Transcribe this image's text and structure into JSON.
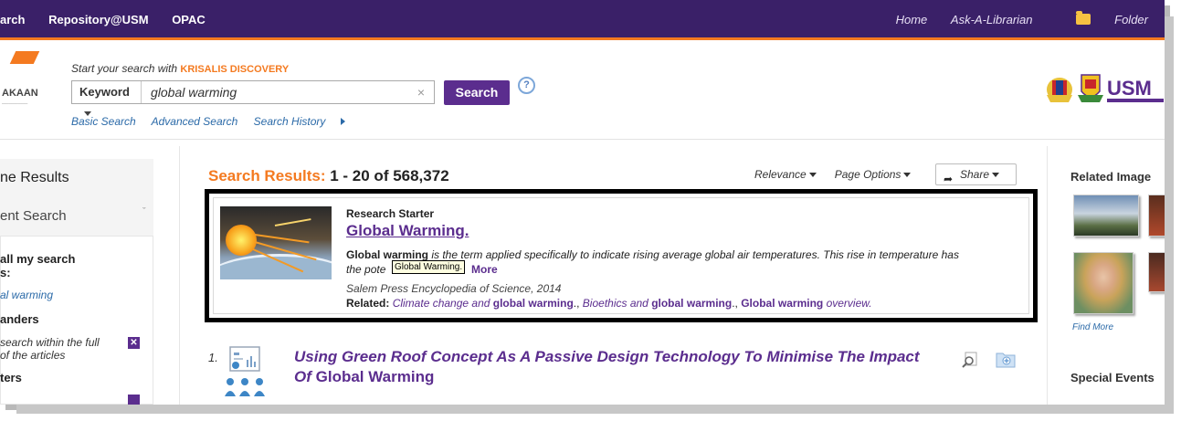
{
  "topbar": {
    "left_links": [
      "arch",
      "Repository@USM",
      "OPAC"
    ],
    "right_links": [
      "Home",
      "Ask-A-Librarian"
    ],
    "folder_label": "Folder",
    "folder_icon": "folder-icon"
  },
  "header": {
    "logo_text": "AKAAN",
    "tagline_prefix": "Start your search with",
    "tagline_brand": "KRISALIS DISCOVERY",
    "search": {
      "field_type": "Keyword",
      "query": "global warming",
      "clear": "×",
      "button": "Search",
      "help": "?"
    },
    "sublinks": [
      "Basic Search",
      "Advanced Search",
      "Search History"
    ],
    "partner_logo": "USM"
  },
  "left": {
    "heading": "ne Results",
    "subheading": "ent Search",
    "option1_line1": "all my search",
    "option1_line2": "s:",
    "option1_value": "al warming",
    "expanders_label": "anders",
    "expander_line1": "search within the full",
    "expander_line2": "of the articles",
    "filters_label": "ters"
  },
  "main": {
    "results_label": "Search Results:",
    "results_range": "1 - 20 of 568,372",
    "sort": "Relevance",
    "page_options": "Page Options",
    "share": "Share",
    "research_starter": {
      "label": "Research Starter",
      "title": "Global Warming.",
      "desc_bold": "Global warming",
      "desc_rest": " is the term applied specifically to indicate rising average global air temperatures. This rise in temperature has",
      "desc_line2": "the pote",
      "tooltip": "Global Warming.",
      "more": "More",
      "source": "Salem Press Encyclopedia of Science, 2014",
      "related_label": "Related:",
      "related_1_pre": "Climate change and",
      "related_1_bold": "global warming",
      "related_2_pre": "Bioethics and",
      "related_2_bold": "global warming",
      "related_3_bold": "Global warming",
      "related_3_post": "overview."
    },
    "result1": {
      "number": "1.",
      "title_pre": "Using Green Roof Concept As A Passive Design Technology To Minimise The Impact Of",
      "title_bold": "Global Warming"
    }
  },
  "right": {
    "related_images": "Related Image",
    "find_more": "Find More",
    "special_events": "Special Events"
  },
  "colors": {
    "topbar": "#3a2068",
    "accent_orange": "#f47a20",
    "purple": "#5b2d8e",
    "link_blue": "#2b6aa8"
  }
}
